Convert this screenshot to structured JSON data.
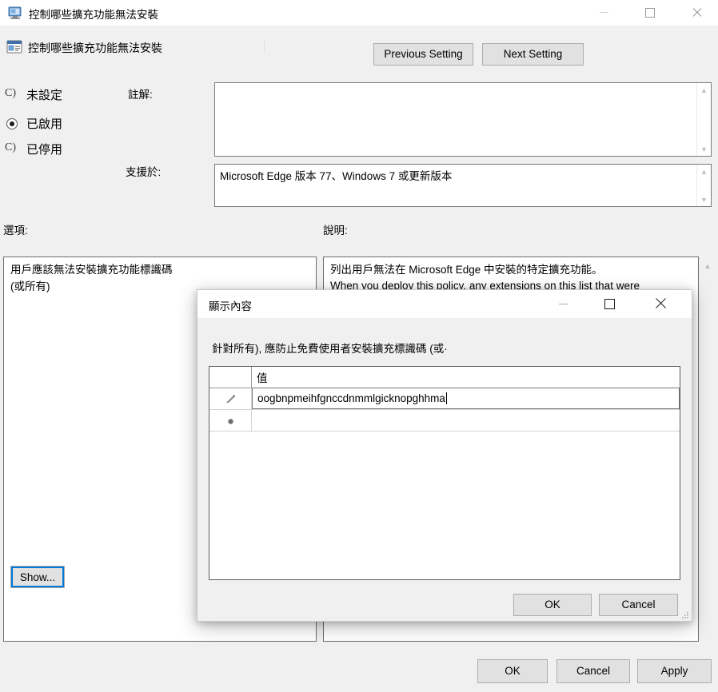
{
  "window": {
    "title": "控制哪些擴充功能無法安裝",
    "icon": "monitor-icon",
    "controls": {
      "minimize": "—",
      "maximize": "□",
      "close": "✕"
    }
  },
  "header": {
    "policy_icon": "policy-setting-icon",
    "policy_title": "控制哪些擴充功能無法安裝",
    "previous_setting": "Previous Setting",
    "next_setting": "Next Setting"
  },
  "state": {
    "options": [
      {
        "label": "未設定",
        "selected": false
      },
      {
        "label": "已啟用",
        "selected": true
      },
      {
        "label": "已停用",
        "selected": false
      }
    ]
  },
  "fields": {
    "comment_label": "註解:",
    "comment_value": "",
    "supported_label": "支援於:",
    "supported_value": "Microsoft Edge 版本 77、Windows 7 或更新版本"
  },
  "panels": {
    "options_label": "選項:",
    "options_text_line1": "用戶應該無法安裝擴充功能標識碼",
    "options_text_line2": "(或所有)",
    "show_button": "Show...",
    "help_label": "說明:",
    "help_text_line1": "列出用戶無法在 Microsoft Edge 中安裝的特定擴充功能。",
    "help_text_line2": "When you deploy this policy, any extensions on this list that were"
  },
  "footer": {
    "ok": "OK",
    "cancel": "Cancel",
    "apply": "Apply"
  },
  "dialog": {
    "title": "顯示內容",
    "prompt": "針對所有), 應防止免費使用者安裝擴充標識碼 (或·",
    "controls": {
      "minimize": "—",
      "maximize": "□",
      "close": "✕"
    },
    "grid": {
      "column_header": "值",
      "rows": [
        {
          "marker": "edit-pencil-icon",
          "value": "oogbnpmeihfgnccdnmmlgicknopghhma",
          "editing": true
        },
        {
          "marker": "new-row-icon",
          "value": "",
          "editing": false
        }
      ]
    },
    "buttons": {
      "ok": "OK",
      "cancel": "Cancel"
    }
  },
  "colors": {
    "window_bg": "#f0f0f0",
    "titlebar_bg": "#ffffff",
    "focus_blue": "#0078d7",
    "button_face": "#e1e1e1",
    "border": "#adadad"
  }
}
